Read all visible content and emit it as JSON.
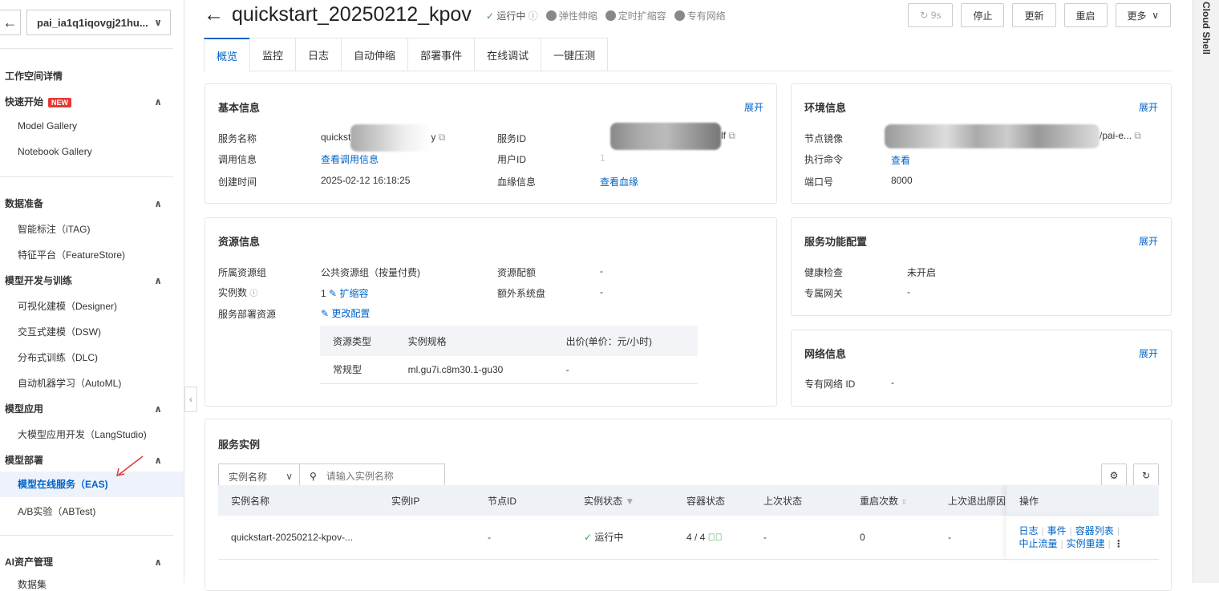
{
  "workspace": {
    "name": "pai_ia1q1iqovgj21hu..."
  },
  "sidebar": {
    "workspace_detail": "工作空间详情",
    "sections": [
      {
        "label": "快速开始",
        "badge": "NEW",
        "items": [
          "Model Gallery",
          "Notebook Gallery"
        ]
      },
      {
        "label": "数据准备",
        "items": [
          "智能标注（iTAG)",
          "特征平台（FeatureStore)"
        ]
      },
      {
        "label": "模型开发与训练",
        "items": [
          "可视化建模（Designer)",
          "交互式建模（DSW)",
          "分布式训练（DLC)",
          "自动机器学习（AutoML)"
        ]
      },
      {
        "label": "模型应用",
        "items": [
          "大模型应用开发（LangStudio)"
        ]
      },
      {
        "label": "模型部署",
        "items": [
          "模型在线服务（EAS)",
          "A/B实验（ABTest)"
        ]
      },
      {
        "label": "AI资产管理",
        "items": [
          "数据集"
        ]
      }
    ]
  },
  "header": {
    "title": "quickstart_20250212_kpov",
    "status": "运行中",
    "tags": [
      "弹性伸缩",
      "定时扩缩容",
      "专有网络"
    ],
    "buttons": {
      "refresh": "9s",
      "stop": "停止",
      "update": "更新",
      "restart": "重启",
      "more": "更多"
    }
  },
  "tabs": [
    "概览",
    "监控",
    "日志",
    "自动伸缩",
    "部署事件",
    "在线调试",
    "一键压测"
  ],
  "cloud_shell": "Cloud Shell",
  "basic": {
    "title": "基本信息",
    "expand": "展开",
    "service_name_label": "服务名称",
    "service_name_prefix": "quickst",
    "service_name_suffix": "y",
    "call_label": "调用信息",
    "call_link": "查看调用信息",
    "created_label": "创建时间",
    "created": "2025-02-12 16:18:25",
    "service_id_label": "服务ID",
    "service_id_suffix": "lf",
    "user_id_label": "用户ID",
    "user_id": "1",
    "lineage_label": "血缘信息",
    "lineage_link": "查看血缘"
  },
  "env": {
    "title": "环境信息",
    "expand": "展开",
    "image_label": "节点镜像",
    "image_suffix": "/pai-e...",
    "cmd_label": "执行命令",
    "cmd_link": "查看",
    "port_label": "端口号",
    "port": "8000"
  },
  "resource": {
    "title": "资源信息",
    "group_label": "所属资源组",
    "group": "公共资源组（按量付费)",
    "quota_label": "资源配额",
    "quota": "-",
    "instances_label": "实例数",
    "instances": "1",
    "scale_link": "扩缩容",
    "disk_label": "额外系统盘",
    "disk": "-",
    "deploy_label": "服务部署资源",
    "change_link": "更改配置",
    "table": {
      "headers": [
        "资源类型",
        "实例规格",
        "出价(单价：元/小时)"
      ],
      "rows": [
        [
          "常规型",
          "ml.gu7i.c8m30.1-gu30",
          "-"
        ]
      ]
    }
  },
  "func": {
    "title": "服务功能配置",
    "expand": "展开",
    "health_label": "健康检查",
    "health": "未开启",
    "gateway_label": "专属网关",
    "gateway": "-"
  },
  "network": {
    "title": "网络信息",
    "expand": "展开",
    "vpc_label": "专有网络 ID",
    "vpc": "-"
  },
  "instances": {
    "title": "服务实例",
    "filter": "实例名称",
    "search_placeholder": "请输入实例名称",
    "headers": [
      "实例名称",
      "实例IP",
      "节点ID",
      "实例状态",
      "容器状态",
      "上次状态",
      "重启次数",
      "上次退出原因",
      "操作"
    ],
    "rows": [
      {
        "name": "quickstart-20250212-kpov-...",
        "ip": "",
        "node": "-",
        "status": "运行中",
        "container": "4 / 4",
        "last": "-",
        "restarts": "0",
        "exit": "-",
        "ops": [
          "日志",
          "事件",
          "容器列表",
          "中止流量",
          "实例重建"
        ]
      }
    ]
  }
}
